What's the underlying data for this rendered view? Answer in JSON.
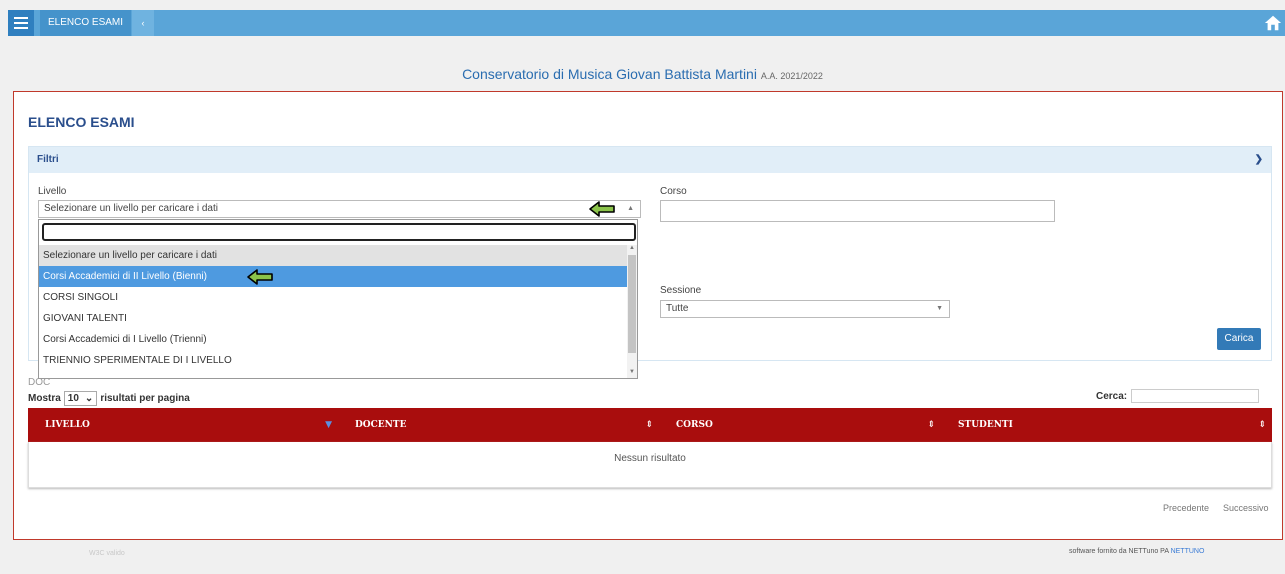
{
  "topbar": {
    "breadcrumb": "ELENCO ESAMI",
    "breadcrumb_arrow": "‹"
  },
  "header": {
    "title": "Conservatorio di Musica Giovan Battista Martini",
    "academic_year": "A.A. 2021/2022"
  },
  "page_title": "ELENCO ESAMI",
  "filters": {
    "title": "Filtri",
    "livello_label": "Livello",
    "livello_value": "Selezionare un livello per caricare i dati",
    "corso_label": "Corso",
    "corso_value": "",
    "sessione_label": "Sessione",
    "sessione_value": "Tutte",
    "carica_label": "Carica"
  },
  "dropdown": {
    "search_value": "",
    "options": [
      "Selezionare un livello per caricare i dati",
      "Corsi Accademici di II Livello (Bienni)",
      "CORSI SINGOLI",
      "GIOVANI TALENTI",
      "Corsi Accademici di I Livello (Trienni)",
      "TRIENNIO SPERIMENTALE DI I LIVELLO"
    ],
    "selected_index": 1
  },
  "table": {
    "partial_label": "DOC",
    "show_prefix": "Mostra",
    "page_size": "10",
    "show_suffix": "risultati per pagina",
    "search_label": "Cerca:",
    "search_value": "",
    "columns": [
      "LIVELLO",
      "DOCENTE",
      "CORSO",
      "STUDENTI"
    ],
    "empty_message": "Nessun risultato",
    "prev_label": "Precedente",
    "next_label": "Successivo"
  },
  "footer": {
    "left": "W3C valido",
    "right": "software fornito da NETTuno PA",
    "logo": "NETTUNO"
  },
  "colors": {
    "topbar": "#5aa5d8",
    "table_header": "#a90d0d",
    "selection": "#4e9ae0",
    "arrow_fill": "#8bc34a"
  },
  "icons": [
    "menu-icon",
    "home-icon",
    "chevron-down-icon",
    "sort-icon",
    "left-arrow-icon"
  ]
}
